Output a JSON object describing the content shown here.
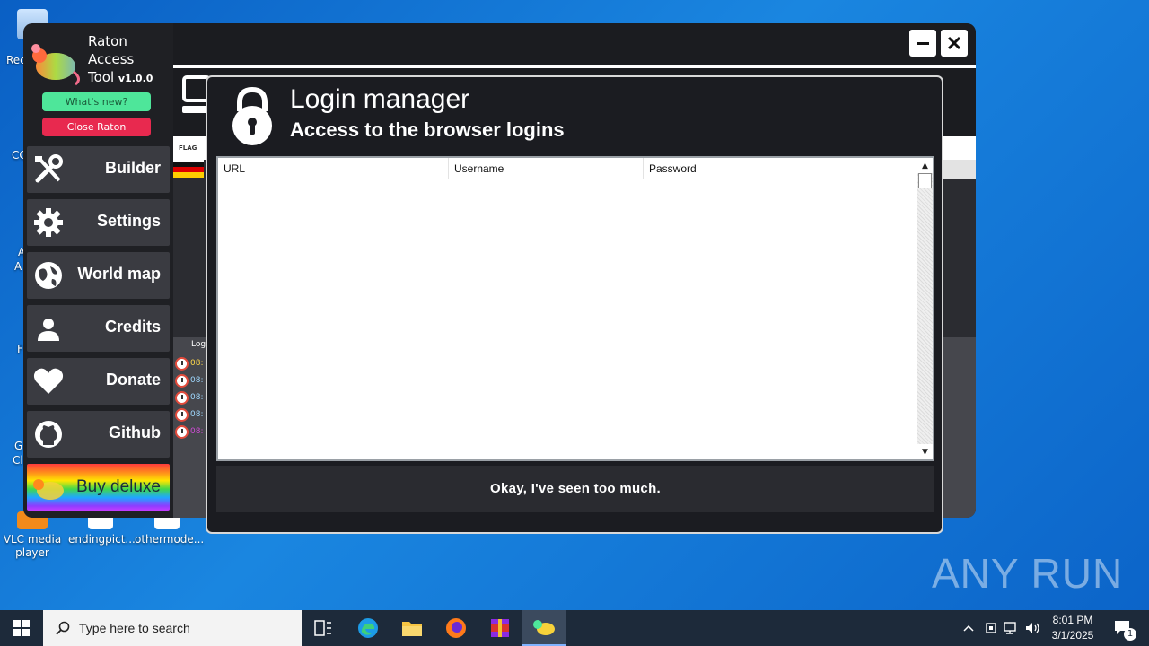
{
  "desktop": {
    "icons": [
      {
        "label": "Rec"
      },
      {
        "label": "VLC media player"
      },
      {
        "label": "endingpict..."
      },
      {
        "label": "othermode..."
      }
    ],
    "edge_labels": [
      "CC",
      "A",
      "A",
      "F",
      "G",
      "Cl"
    ]
  },
  "main_window": {
    "flag_header": "FLAG",
    "log_header": "Log",
    "log_rows": [
      {
        "text": "08:",
        "color": "#ffd84a"
      },
      {
        "text": "08:",
        "color": "#9fd8ff"
      },
      {
        "text": "08:",
        "color": "#9fd8ff"
      },
      {
        "text": "08:",
        "color": "#9fd8ff"
      },
      {
        "text": "08:",
        "color": "#d24bd8"
      }
    ]
  },
  "sidebar": {
    "brand_line1": "Raton",
    "brand_line2": "Access",
    "brand_line3": "Tool",
    "version": "v1.0.0",
    "whats_new": "What's new?",
    "close": "Close Raton",
    "items": [
      {
        "label": "Builder",
        "icon": "tools-icon"
      },
      {
        "label": "Settings",
        "icon": "gear-icon"
      },
      {
        "label": "World map",
        "icon": "globe-icon"
      },
      {
        "label": "Credits",
        "icon": "person-icon"
      },
      {
        "label": "Donate",
        "icon": "heart-icon"
      },
      {
        "label": "Github",
        "icon": "github-icon"
      }
    ],
    "buy_deluxe": "Buy deluxe"
  },
  "dialog": {
    "title": "Login manager",
    "subtitle": "Access to the browser logins",
    "columns": [
      "URL",
      "Username",
      "Password"
    ],
    "rows": [],
    "ok_button": "Okay, I've seen too much."
  },
  "watermark": "ANY RUN",
  "taskbar": {
    "search_placeholder": "Type here to search",
    "time": "8:01 PM",
    "date": "3/1/2025",
    "notification_count": "1"
  },
  "colors": {
    "accent_green": "#4ee69a",
    "accent_red": "#e8294f",
    "panel_dark": "#1f2024"
  }
}
